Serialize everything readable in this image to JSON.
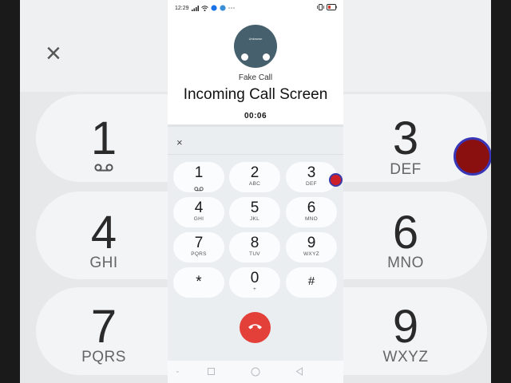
{
  "status_bar": {
    "time": "12:29",
    "icons": [
      "signal-icon",
      "wifi-icon",
      "notification-icon",
      "more-icon",
      "vibrate-icon",
      "battery-icon"
    ]
  },
  "caller": {
    "avatar_label": "Unknown",
    "label": "Fake Call",
    "title": "Incoming Call Screen",
    "timer": "00:06"
  },
  "dialpad": {
    "close_symbol": "×",
    "keys": [
      {
        "num": "1",
        "sub": "voicemail-icon"
      },
      {
        "num": "2",
        "sub": "ABC"
      },
      {
        "num": "3",
        "sub": "DEF"
      },
      {
        "num": "4",
        "sub": "GHI"
      },
      {
        "num": "5",
        "sub": "JKL"
      },
      {
        "num": "6",
        "sub": "MNO"
      },
      {
        "num": "7",
        "sub": "PQRS"
      },
      {
        "num": "8",
        "sub": "TUV"
      },
      {
        "num": "9",
        "sub": "WXYZ"
      },
      {
        "num": "*",
        "sub": ""
      },
      {
        "num": "0",
        "sub": "+"
      },
      {
        "num": "#",
        "sub": ""
      }
    ]
  },
  "end_call": {
    "icon": "end-call-icon",
    "color": "#e3403a"
  },
  "nav": {
    "icons": [
      "back-chevron-icon",
      "recents-square-icon",
      "home-circle-icon",
      "back-triangle-icon"
    ]
  },
  "background_zoom": {
    "left": {
      "close_symbol": "×",
      "keys": [
        {
          "num": "1",
          "sub": ""
        },
        {
          "num": "4",
          "sub": "GHI"
        },
        {
          "num": "7",
          "sub": "PQRS"
        }
      ]
    },
    "right": {
      "keys": [
        {
          "num": "3",
          "sub": "DEF"
        },
        {
          "num": "6",
          "sub": "MNO"
        },
        {
          "num": "9",
          "sub": "WXYZ"
        }
      ]
    }
  },
  "colors": {
    "touch_indicator": "#cc1f2a",
    "touch_ring": "#3c3aa8"
  }
}
